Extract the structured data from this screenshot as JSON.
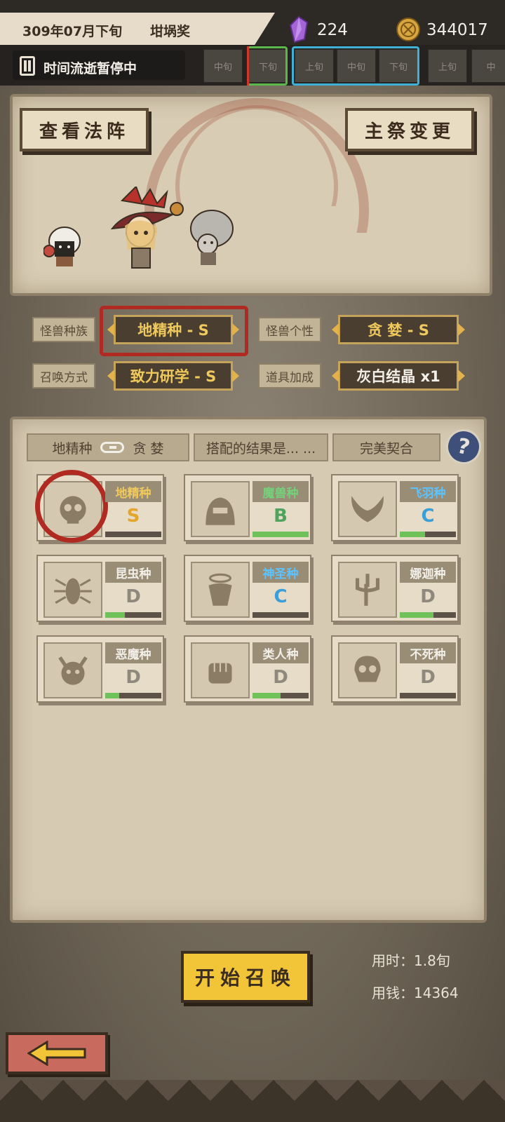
{
  "header": {
    "date": "309年07月下旬",
    "award": "坩埚奖",
    "crystal_count": "224",
    "coin_count": "344017"
  },
  "timeline": {
    "pause_label": "时间流逝暂停中",
    "slots": [
      "中旬",
      "下旬",
      "上旬",
      "中旬",
      "下旬",
      "上旬",
      "中"
    ]
  },
  "stage": {
    "view_array_label": "查看法阵",
    "change_priest_label": "主祭变更"
  },
  "selectors": {
    "race_label": "怪兽种族",
    "race_value": "地精种 - S",
    "personality_label": "怪兽个性",
    "personality_value": "贪 婪 - S",
    "summon_label": "召唤方式",
    "summon_value": "致力研学 - S",
    "item_label": "道具加成",
    "item_value": "灰白结晶 x1"
  },
  "result": {
    "race": "地精种",
    "personality": "贪 婪",
    "question": "搭配的结果是... ...",
    "answer": "完美契合"
  },
  "races": [
    {
      "name": "地精种",
      "grade": "S",
      "grade_color": "#e3a52a",
      "name_color": "#f0c95c",
      "progress": 0.0,
      "icon": "goblin-skull-icon"
    },
    {
      "name": "魔兽种",
      "grade": "B",
      "grade_color": "#4fa35d",
      "name_color": "#74d07a",
      "progress": 1.0,
      "icon": "beast-icon"
    },
    {
      "name": "飞羽种",
      "grade": "C",
      "grade_color": "#3a9fd8",
      "name_color": "#5cc3ff",
      "progress": 0.45,
      "icon": "wing-icon"
    },
    {
      "name": "昆虫种",
      "grade": "D",
      "grade_color": "#8f887d",
      "name_color": "#f2efe8",
      "progress": 0.35,
      "icon": "insect-icon"
    },
    {
      "name": "神圣种",
      "grade": "C",
      "grade_color": "#3a9fd8",
      "name_color": "#5cc3ff",
      "progress": 0.0,
      "icon": "holy-icon"
    },
    {
      "name": "娜迦种",
      "grade": "D",
      "grade_color": "#8f887d",
      "name_color": "#f2efe8",
      "progress": 0.6,
      "icon": "trident-icon"
    },
    {
      "name": "恶魔种",
      "grade": "D",
      "grade_color": "#8f887d",
      "name_color": "#f2efe8",
      "progress": 0.25,
      "icon": "demon-icon"
    },
    {
      "name": "类人种",
      "grade": "D",
      "grade_color": "#8f887d",
      "name_color": "#f2efe8",
      "progress": 0.5,
      "icon": "fist-icon"
    },
    {
      "name": "不死种",
      "grade": "D",
      "grade_color": "#8f887d",
      "name_color": "#f2efe8",
      "progress": 0.0,
      "icon": "undead-skull-icon"
    }
  ],
  "footer": {
    "summon_label": "开始召唤",
    "time_used": "用时：1.8旬",
    "money_used": "用钱：14364"
  }
}
